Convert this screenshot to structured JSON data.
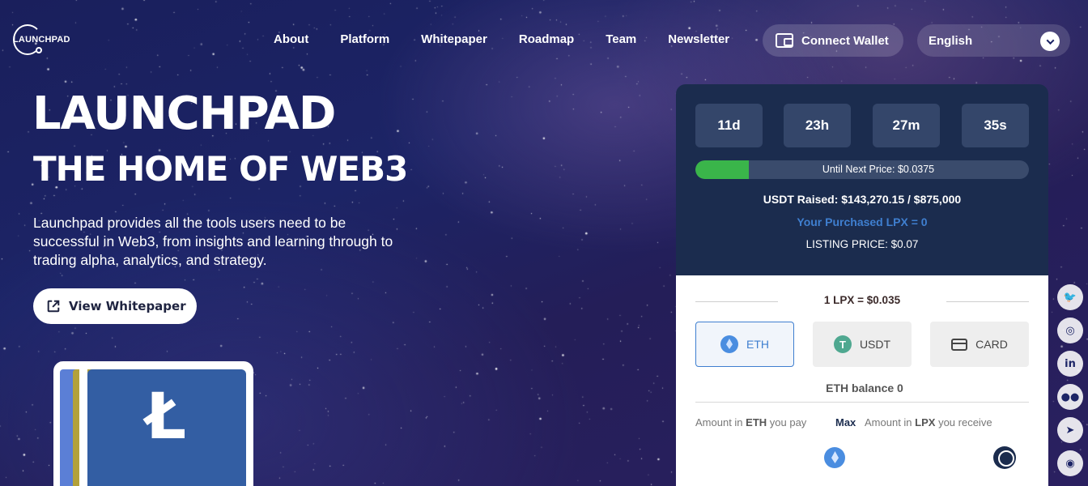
{
  "header": {
    "logo_text": "LAUNCHPAD",
    "nav": [
      "About",
      "Platform",
      "Whitepaper",
      "Roadmap",
      "Team",
      "Newsletter"
    ],
    "connect_wallet": "Connect Wallet",
    "language": "English"
  },
  "hero": {
    "title": "LAUNCHPAD",
    "subtitle": "THE HOME OF WEB3",
    "description": "Launchpad provides all the tools users need to be successful in Web3, from insights and learning through to trading alpha, analytics, and strategy.",
    "cta": "View Whitepaper",
    "card_glyph": "Ł"
  },
  "presale": {
    "timer": {
      "days": "11d",
      "hours": "23h",
      "minutes": "27m",
      "seconds": "35s"
    },
    "progress": {
      "label": "Until Next Price: $0.0375",
      "fraction": 0.16
    },
    "raised": "USDT Raised: $143,270.15 / $875,000",
    "purchased": "Your Purchased LPX = 0",
    "listing": "LISTING PRICE: $0.07",
    "rate": "1 LPX = $0.035",
    "pay_options": [
      {
        "label": "ETH",
        "icon": "eth-icon",
        "active": true
      },
      {
        "label": "USDT",
        "icon": "usdt-icon",
        "active": false
      },
      {
        "label": "CARD",
        "icon": "card-icon",
        "active": false
      }
    ],
    "usdt_glyph": "T",
    "balance": "ETH balance 0",
    "amount_pay": {
      "prefix": "Amount in ",
      "token": "ETH",
      "suffix": " you pay"
    },
    "max": "Max",
    "amount_receive": {
      "prefix": "Amount in ",
      "token": "LPX",
      "suffix": " you receive"
    }
  },
  "socials": [
    {
      "name": "twitter-icon",
      "glyph": "🐦"
    },
    {
      "name": "instagram-icon",
      "glyph": "◎"
    },
    {
      "name": "linkedin-icon",
      "glyph": "in"
    },
    {
      "name": "medium-icon",
      "glyph": "●●"
    },
    {
      "name": "telegram-icon",
      "glyph": "➤"
    },
    {
      "name": "discord-icon",
      "glyph": "◉"
    }
  ],
  "colors": {
    "panel_dark": "#1b2c4e",
    "progress_green": "#3ab54a",
    "accent_blue": "#3f7fd0"
  }
}
